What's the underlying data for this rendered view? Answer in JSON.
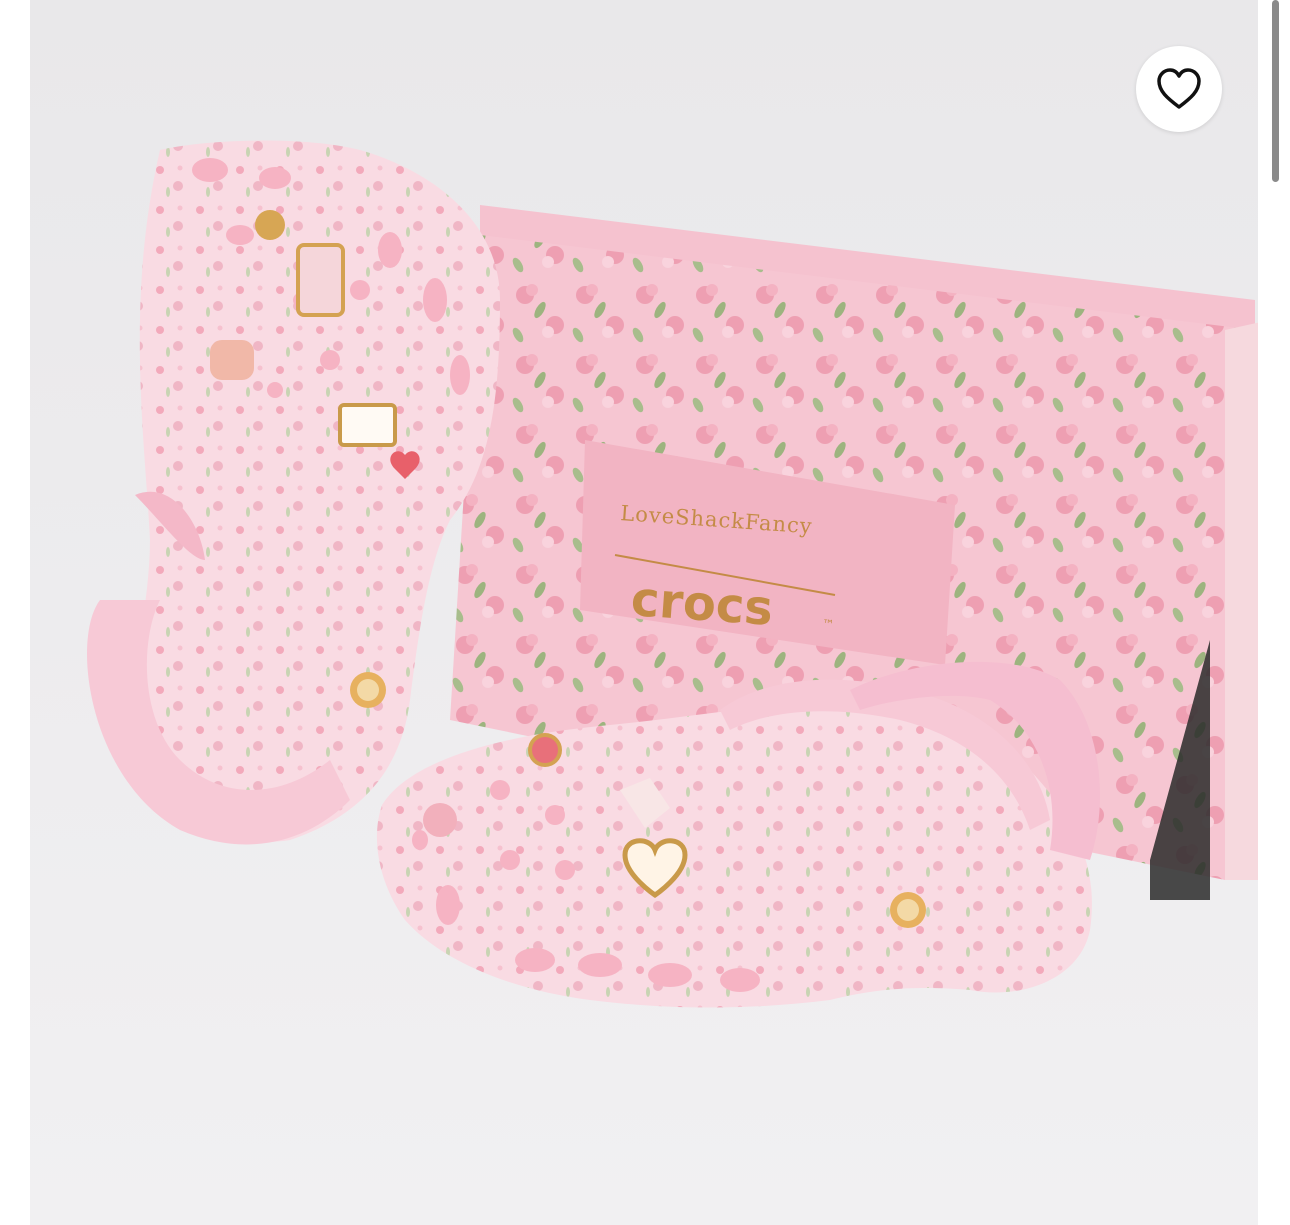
{
  "product_image": {
    "box_brand_collab": "LoveShackFancy",
    "box_brand_main": "crocs",
    "box_trademark": "™"
  },
  "favorite_button": {
    "icon": "heart-outline-icon"
  },
  "colors": {
    "clog_pink": "#f7c9d6",
    "box_pink": "#f3b5c4",
    "charm_gold": "#c99a4a",
    "background": "#ecebed"
  }
}
